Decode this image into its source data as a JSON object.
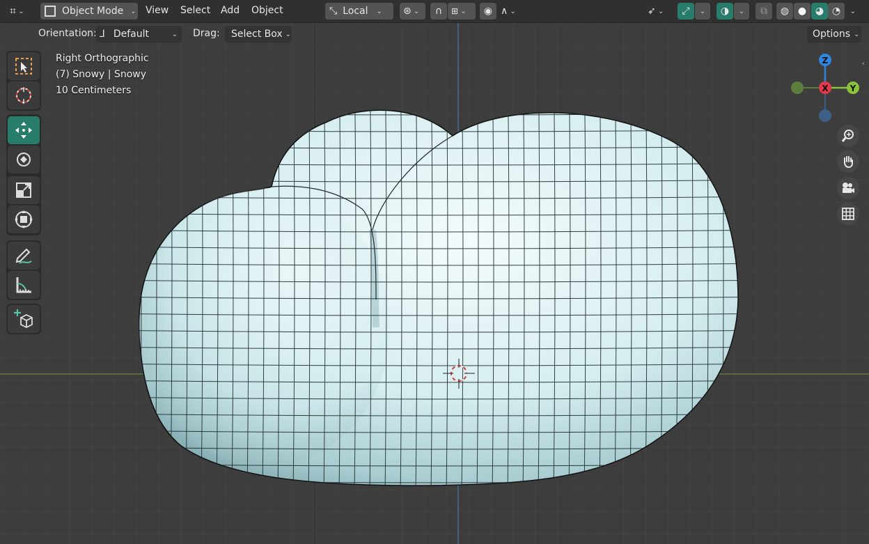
{
  "header": {
    "mode_label": "Object Mode",
    "menus": [
      "View",
      "Select",
      "Add",
      "Object"
    ],
    "transform_orientation": "Local",
    "icons": [
      "editor-type-icon",
      "object-mode-icon",
      "transform-pivot-icon",
      "pivot-point-icon",
      "snap-icon",
      "snap-increment-icon",
      "proportional-edit-icon",
      "falloff-icon",
      "visibility-icon",
      "gizmo-icon",
      "overlay-icon",
      "xray-icon",
      "wireframe-shading-icon",
      "solid-shading-icon",
      "material-shading-icon",
      "rendered-shading-icon"
    ]
  },
  "subheader": {
    "orientation_label": "Orientation:",
    "orientation_value": "Default",
    "drag_label": "Drag:",
    "drag_value": "Select Box",
    "options_label": "Options"
  },
  "overlay_text": {
    "view_name": "Right Orthographic",
    "object_info": "(7) Snowy | Snowy",
    "grid_scale": "10 Centimeters"
  },
  "toolbar": {
    "tools": [
      "select-box-icon",
      "cursor-icon",
      "move-icon",
      "rotate-icon",
      "scale-icon",
      "transform-icon",
      "annotate-icon",
      "measure-icon",
      "add-cube-icon"
    ],
    "active_tool": "move-icon"
  },
  "gizmo": {
    "axis_labels": {
      "z": "Z",
      "x": "X",
      "y": "Y"
    }
  },
  "colors": {
    "accent": "#287d6a",
    "x_axis": "#e3394d",
    "y_axis": "#8bc33a",
    "z_axis": "#2f85e0",
    "mesh": "#cfeaec",
    "background": "#3d3d3d"
  }
}
